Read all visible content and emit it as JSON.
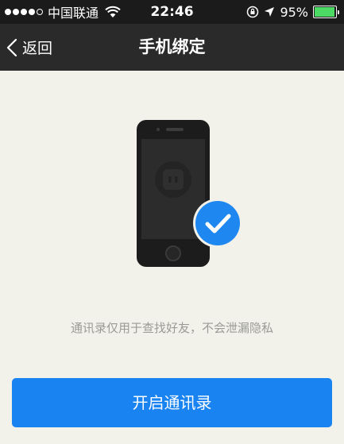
{
  "status_bar": {
    "carrier": "中国联通",
    "time": "22:46",
    "battery_percent": "95%",
    "battery_level": 0.95,
    "icons": [
      "signal-dots",
      "wifi-icon",
      "orientation-lock-icon",
      "location-arrow-icon",
      "battery-icon"
    ]
  },
  "nav": {
    "back_label": "返回",
    "title": "手机绑定"
  },
  "main": {
    "hint": "通讯录仅用于查找好友，不会泄漏隐私",
    "button_label": "开启通讯录"
  },
  "colors": {
    "status_bg": "#1b1b1b",
    "nav_bg": "#2a2a2a",
    "page_bg": "#f2f1ea",
    "accent": "#1983f2",
    "check_badge": "#1e88f0",
    "hint_text": "#9b9b96"
  }
}
